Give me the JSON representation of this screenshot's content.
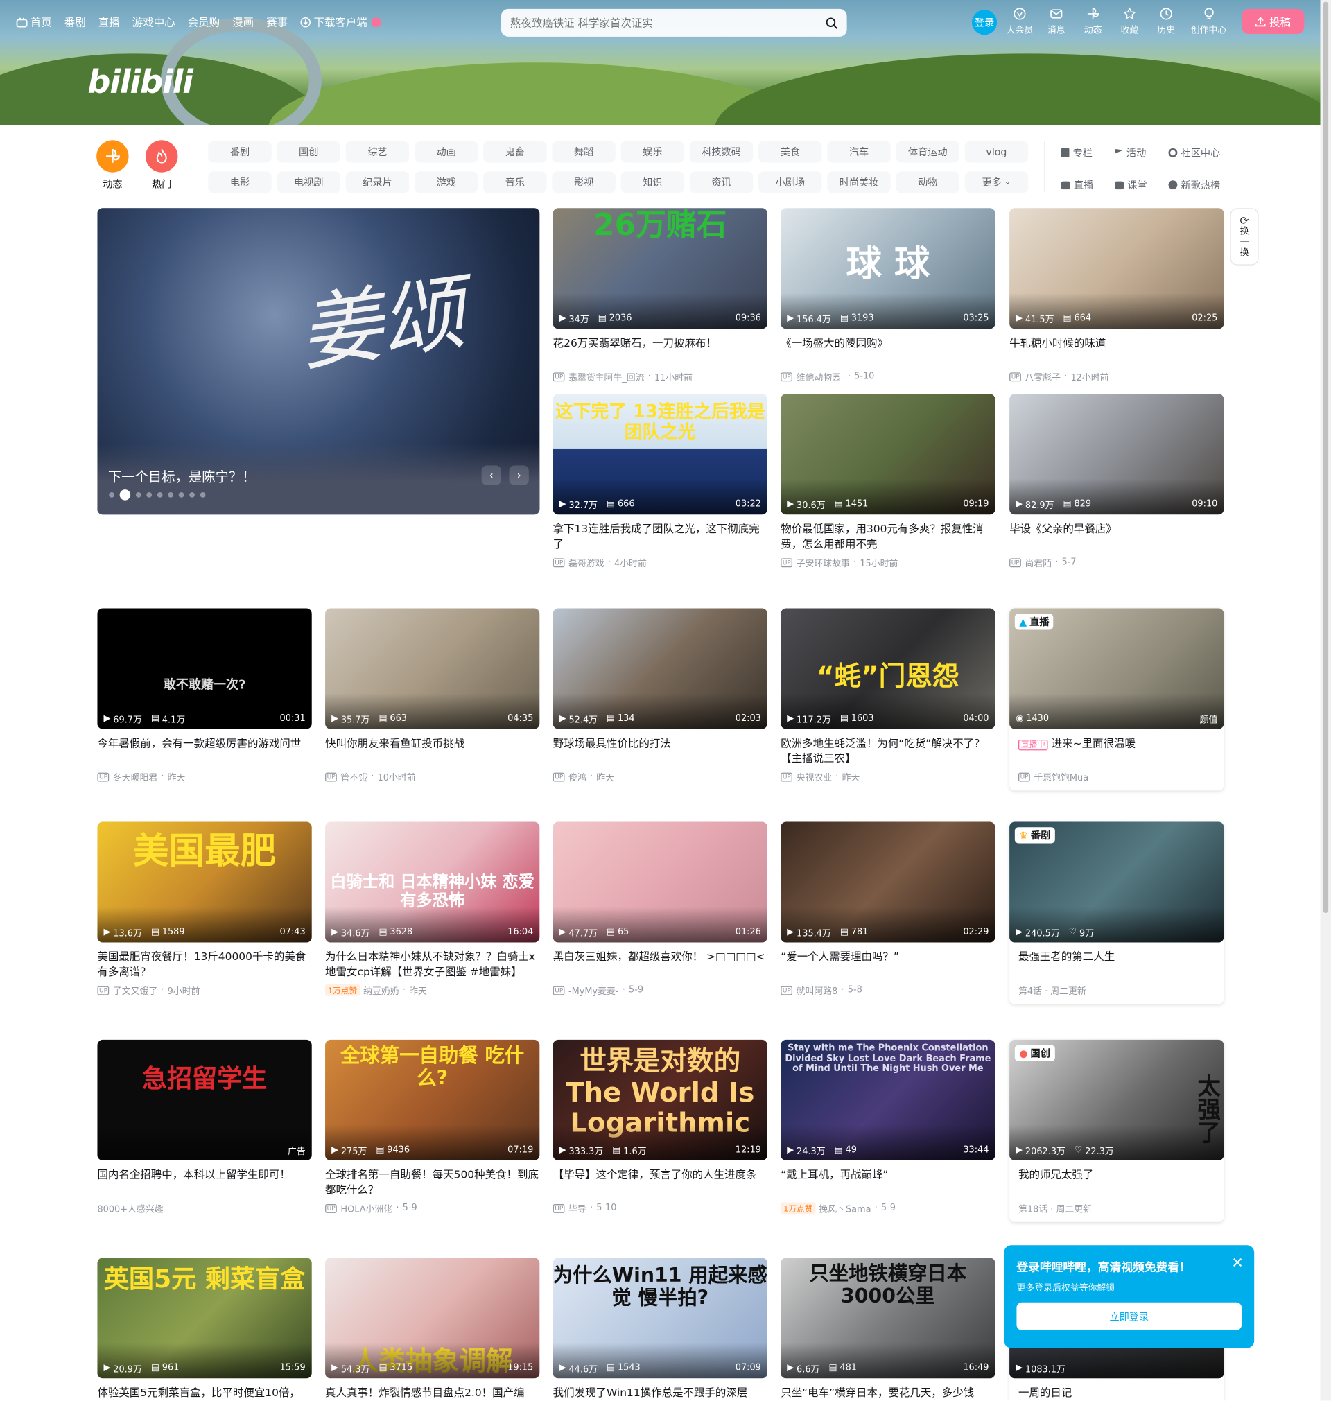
{
  "header": {
    "nav": [
      "首页",
      "番剧",
      "直播",
      "游戏中心",
      "会员购",
      "漫画",
      "赛事",
      "下载客户端"
    ],
    "search_placeholder": "熬夜致癌铁证 科学家首次证实",
    "login": "登录",
    "right_nav": [
      "大会员",
      "消息",
      "动态",
      "收藏",
      "历史",
      "创作中心"
    ],
    "upload": "投稿",
    "logo": "bilibili"
  },
  "quick": {
    "dynamic": "动态",
    "hot": "热门"
  },
  "channels": [
    "番剧",
    "国创",
    "综艺",
    "动画",
    "鬼畜",
    "舞蹈",
    "娱乐",
    "科技数码",
    "美食",
    "汽车",
    "体育运动",
    "vlog",
    "电影",
    "电视剧",
    "纪录片",
    "游戏",
    "音乐",
    "影视",
    "知识",
    "资讯",
    "小剧场",
    "时尚美妆",
    "动物",
    "更多"
  ],
  "side_links": [
    "专栏",
    "活动",
    "社区中心",
    "直播",
    "课堂",
    "新歌热榜"
  ],
  "carousel": {
    "title": "下一个目标，是陈宁？！",
    "art": "姜颂"
  },
  "refresh": [
    "换",
    "一",
    "换"
  ],
  "videos": [
    {
      "art": "26万赌石",
      "views": "34万",
      "danmaku": "2036",
      "duration": "09:36",
      "title": "花26万买翡翠赌石，一刀披麻布！",
      "up": "翡翠货主阿牛_回流",
      "date": "11小时前"
    },
    {
      "art": "球 球",
      "views": "156.4万",
      "danmaku": "3193",
      "duration": "03:25",
      "title": "《一场盛大的陵园购》",
      "up": "维他动物园-",
      "date": "5-10"
    },
    {
      "art": "",
      "views": "41.5万",
      "danmaku": "664",
      "duration": "02:25",
      "title": "牛轧糖小时候的味道",
      "up": "八零彪子",
      "date": "12小时前"
    },
    {
      "art": "这下完了 13连胜之后我是 团队之光",
      "views": "32.7万",
      "danmaku": "666",
      "duration": "03:22",
      "title": "拿下13连胜后我成了团队之光，这下彻底完了",
      "up": "磊哥游戏",
      "date": "4小时前"
    },
    {
      "art": "",
      "views": "30.6万",
      "danmaku": "1451",
      "duration": "09:19",
      "title": "物价最低国家，用300元有多爽？报复性消费，怎么用都用不完",
      "up": "子安环球故事",
      "date": "15小时前"
    },
    {
      "art": "",
      "views": "82.9万",
      "danmaku": "829",
      "duration": "09:10",
      "title": "毕设《父亲的早餐店》",
      "up": "尚君陌",
      "date": "5-7"
    },
    {
      "art": "敢不敢赌一次?",
      "views": "69.7万",
      "danmaku": "4.1万",
      "duration": "00:31",
      "title": "今年暑假前，会有一款超级厉害的游戏问世",
      "up": "冬天暖阳君",
      "date": "昨天"
    },
    {
      "art": "",
      "views": "35.7万",
      "danmaku": "663",
      "duration": "04:35",
      "title": "快叫你朋友来看鱼缸投币挑战",
      "up": "管不饿",
      "date": "10小时前"
    },
    {
      "art": "",
      "views": "52.4万",
      "danmaku": "134",
      "duration": "02:03",
      "title": "野球场最具性价比的打法",
      "up": "俊鸿",
      "date": "昨天"
    },
    {
      "art": "“蚝”门恩怨",
      "views": "117.2万",
      "danmaku": "1603",
      "duration": "04:00",
      "title": "欧洲多地生蚝泛滥！为何“吃货”解决不了？【主播说三农】",
      "up": "央视农业",
      "date": "昨天"
    },
    {
      "art": "美国最肥",
      "views": "13.6万",
      "danmaku": "1589",
      "duration": "07:43",
      "title": "美国最肥宵夜餐厅！13斤40000千卡的美食有多离谱？",
      "up": "子文又饿了",
      "date": "9小时前"
    },
    {
      "art": "白骑士和 日本精神小妹 恋爱有多恐怖",
      "views": "34.6万",
      "danmaku": "3628",
      "duration": "16:04",
      "title": "为什么日本精神小妹从不缺对象？？白骑士x地雷女cp详解【世界女子图鉴 #地雷妹】",
      "up": "纳豆奶奶",
      "date": "昨天",
      "badge": "1万点赞"
    },
    {
      "art": "",
      "views": "47.7万",
      "danmaku": "65",
      "duration": "01:26",
      "title": "黑白灰三姐妹，都超级喜欢你！ >□□□□<",
      "up": "-MyMy麦麦-",
      "date": "5-9"
    },
    {
      "art": "",
      "views": "135.4万",
      "danmaku": "781",
      "duration": "02:29",
      "title": "“爱一个人需要理由吗？”",
      "up": "就叫阿路8",
      "date": "5-8"
    },
    {
      "art": "急招留学生",
      "views": "",
      "danmaku": "",
      "duration": "广告",
      "title": "国内名企招聘中，本科以上留学生即可！",
      "up": "",
      "date": "",
      "meta": "8000+人感兴趣"
    },
    {
      "art": "全球第一自助餐 吃什么?",
      "views": "275万",
      "danmaku": "9436",
      "duration": "07:19",
      "title": "全球排名第一自助餐！每天500种美食！到底都吃什么？",
      "up": "HOLA小洲佬",
      "date": "5-9"
    },
    {
      "art": "世界是对数的 The World Is Logarithmic",
      "views": "333.3万",
      "danmaku": "1.6万",
      "duration": "12:19",
      "title": "【毕导】这个定律，预言了你的人生进度条",
      "up": "毕导",
      "date": "5-10"
    },
    {
      "art": "Stay with me The Phoenix Constellation Divided Sky Lost Love Dark Beach Frame of Mind Until The Night Hush Over Me",
      "views": "24.3万",
      "danmaku": "49",
      "duration": "33:44",
      "title": "“戴上耳机，再战巅峰”",
      "up": "挽风丶Sama",
      "date": "5-9",
      "badge": "1万点赞"
    },
    {
      "art": "英国5元 剩菜盲盒",
      "views": "20.9万",
      "danmaku": "961",
      "duration": "15:59",
      "title": "体验英国5元剩菜盲盒，比平时便宜10倍，",
      "up": "",
      "date": ""
    },
    {
      "art": "人类抽象调解",
      "views": "54.3万",
      "danmaku": "3715",
      "duration": "19:15",
      "title": "真人真事！炸裂情感节目盘点2.0！国产编",
      "up": "",
      "date": ""
    },
    {
      "art": "为什么Win11 用起来感觉 慢半拍?",
      "views": "44.6万",
      "danmaku": "1543",
      "duration": "07:09",
      "title": "我们发现了Win11操作总是不跟手的深层",
      "up": "",
      "date": ""
    },
    {
      "art": "只坐地铁横穿日本 3000公里",
      "views": "6.6万",
      "danmaku": "481",
      "duration": "16:49",
      "title": "只坐“电车”横穿日本，要花几天，多少钱",
      "up": "",
      "date": ""
    }
  ],
  "specials": [
    {
      "tag": "直播",
      "views": "1430",
      "right": "颜值",
      "living": "直播中",
      "title": "进来~里面很温暖",
      "up": "千惠饱饱Mua"
    },
    {
      "tag": "番剧",
      "views": "240.5万",
      "likes": "9万",
      "title": "最强王者的第二人生",
      "meta": "第4话 · 周二更新"
    },
    {
      "tag": "国创",
      "views": "2062.3万",
      "likes": "22.3万",
      "title": "我的师兄太强了",
      "meta": "第18话 · 周二更新",
      "art": "太强了"
    },
    {
      "views": "1083.1万",
      "title": "一周的日记"
    }
  ],
  "popup": {
    "heading": "登录哔哩哔哩，高清视频免费看！",
    "sub": "更多登录后权益等你解锁",
    "button": "立即登录"
  },
  "colors": {
    "brand_blue": "#00aeec",
    "brand_pink": "#fb7299",
    "orange": "#ff7f24"
  }
}
